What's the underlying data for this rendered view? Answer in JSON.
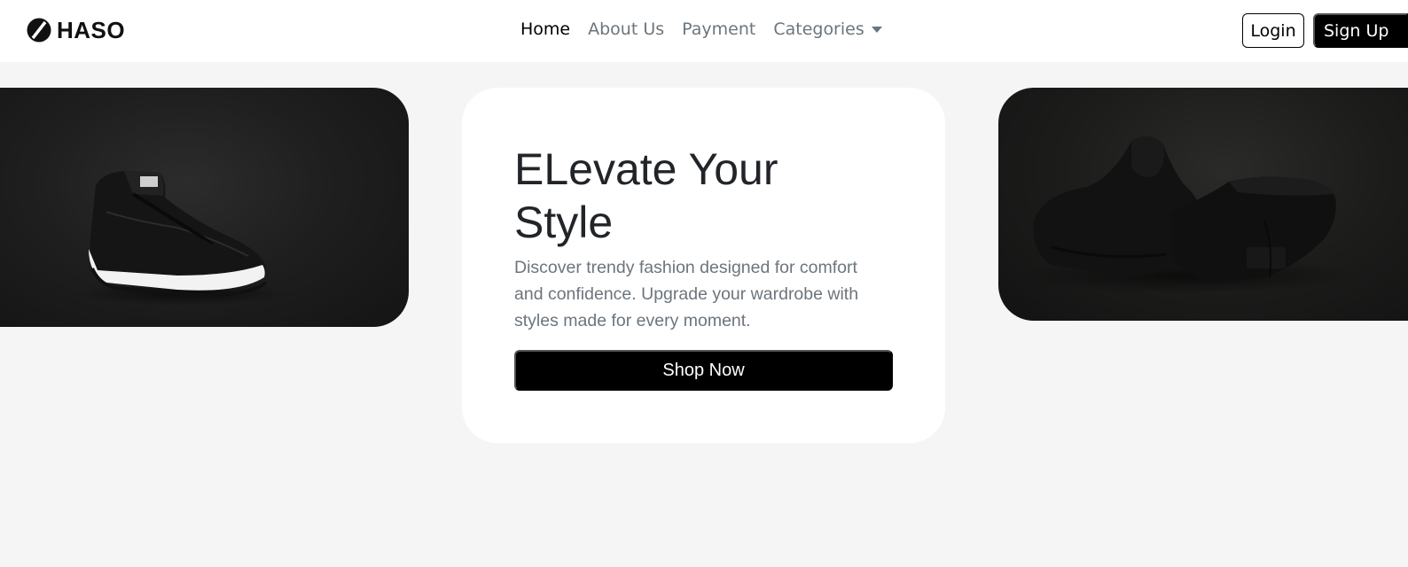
{
  "brand": {
    "name": "HASO",
    "logo_icon": "slash-circle-icon"
  },
  "nav": {
    "links": [
      "Home",
      "About Us",
      "Payment"
    ],
    "active": "Home",
    "dropdown_label": "Categories",
    "dropdown_icon": "caret-down-icon"
  },
  "auth": {
    "login_label": "Login",
    "signup_label": "Sign Up"
  },
  "hero": {
    "title": "ELevate Your Style",
    "description": "Discover trendy fashion designed for comfort and confidence. Upgrade your wardrobe with styles made for every moment.",
    "cta_label": "Shop Now"
  },
  "images": {
    "left": "black-sneaker-image",
    "right": "black-hoodie-and-pants-image"
  },
  "colors": {
    "background": "#f5f5f5",
    "accent": "#000000",
    "muted_text": "#6c757d"
  }
}
